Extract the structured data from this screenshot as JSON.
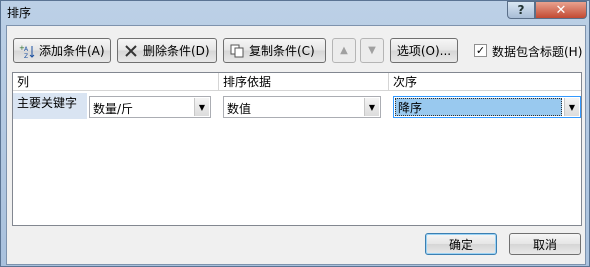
{
  "dialog": {
    "title": "排序",
    "help_label": "?",
    "close_label": "✕"
  },
  "toolbar": {
    "add_label": "添加条件(A)",
    "delete_label": "删除条件(D)",
    "copy_label": "复制条件(C)",
    "up_label": "▲",
    "down_label": "▼",
    "options_label": "选项(O)...",
    "has_header_label": "数据包含标题(H)",
    "has_header_checked": "✓"
  },
  "grid": {
    "headers": {
      "column": "列",
      "sort_on": "排序依据",
      "order": "次序"
    },
    "row": {
      "label": "主要关键字",
      "column_value": "数量/斤",
      "sort_on_value": "数值",
      "order_value": "降序"
    }
  },
  "footer": {
    "ok_label": "确定",
    "cancel_label": "取消"
  },
  "colors": {
    "title_bar": "#bcd0e6",
    "selection": "#99c9ef",
    "close": "#c24a33"
  }
}
